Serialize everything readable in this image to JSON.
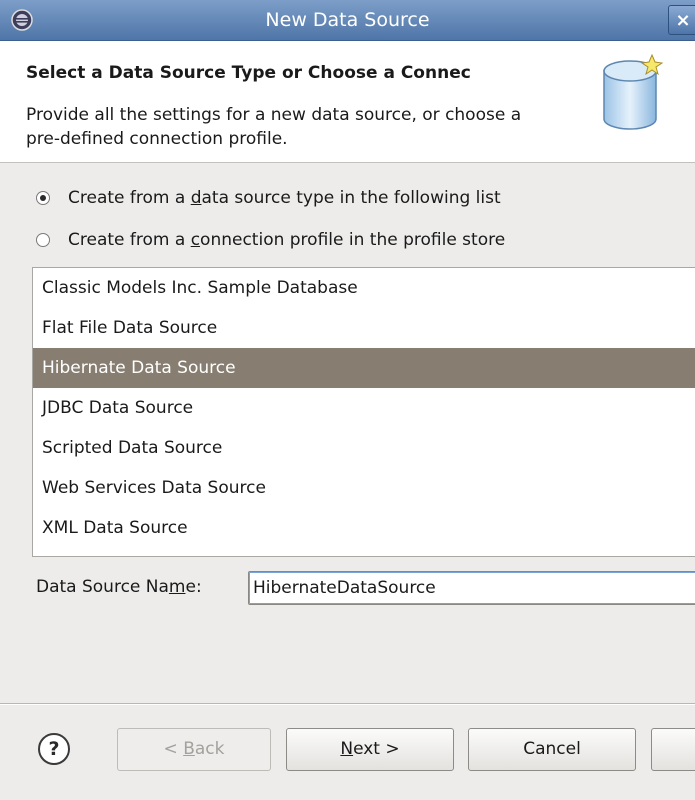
{
  "window": {
    "title": "New Data Source",
    "close_label": "×"
  },
  "banner": {
    "heading": "Select a Data Source Type or Choose a Connec",
    "description": "Provide all the settings for a new data source, or choose a pre-defined connection profile."
  },
  "options": {
    "from_type": {
      "before": "Create from a ",
      "mnemonic": "d",
      "after": "ata source type in the following list",
      "checked": true
    },
    "from_profile": {
      "before": "Create from a ",
      "mnemonic": "c",
      "after": "onnection profile in the profile store",
      "checked": false
    }
  },
  "data_sources": {
    "items": [
      "Classic Models Inc. Sample Database",
      "Flat File Data Source",
      "Hibernate Data Source",
      "JDBC Data Source",
      "Scripted Data Source",
      "Web Services Data Source",
      "XML Data Source"
    ],
    "selected_index": 2
  },
  "name_field": {
    "label_before": "Data Source Na",
    "label_mnemonic": "m",
    "label_after": "e:",
    "value": "HibernateDataSource"
  },
  "buttons": {
    "help": "?",
    "back_prefix": "< ",
    "back_mnemonic": "B",
    "back_suffix": "ack",
    "next_mnemonic": "N",
    "next_suffix": "ext >",
    "cancel": "Cancel"
  },
  "colors": {
    "selection": "#877e71",
    "titlebar": "#4f76a8"
  }
}
